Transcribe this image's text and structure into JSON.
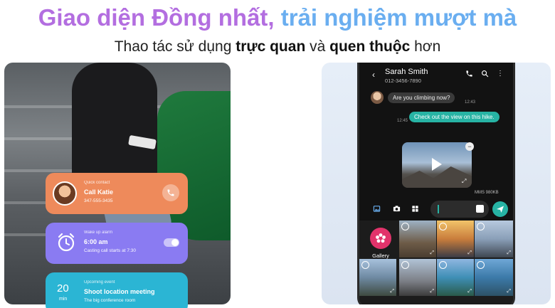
{
  "headline": {
    "part1": "Giao diện Đồng nhất,",
    "part2": "trải nghiệm mượt mà"
  },
  "subheadline": {
    "pre": "Thao tác sử dụng ",
    "bold1": "trực quan",
    "mid": " và ",
    "bold2": "quen thuộc",
    "post": " hơn"
  },
  "cards": {
    "call": {
      "category": "Quick contact",
      "title": "Call Katie",
      "detail": "347-555-3435",
      "icon": "phone-icon",
      "color": "#ee8a5b"
    },
    "alarm": {
      "category": "Wake up alarm",
      "title": "6:00 am",
      "detail": "Casting call starts at 7:30",
      "icon": "alarm-clock-icon",
      "toggle_on": true,
      "color": "#8a7bf2"
    },
    "event": {
      "category": "Upcoming event",
      "title": "Shoot location meeting",
      "detail": "The big conference room",
      "date_num": "20",
      "date_unit": "min",
      "color": "#2bb5d4"
    }
  },
  "messenger": {
    "contact_name": "Sarah Smith",
    "contact_number": "012-3456-7890",
    "messages": [
      {
        "direction": "in",
        "text": "Are you climbing now?",
        "time": "12:43"
      },
      {
        "direction": "out",
        "text": "Check out the view on this hike.",
        "time": "12:45"
      }
    ],
    "attachment": {
      "mms_label": "MMS",
      "size": "980KB"
    },
    "composer": {
      "accent": "#27b3a4"
    },
    "gallery_label": "Gallery",
    "thumbs": [
      {
        "selected": ""
      },
      {
        "selected": ""
      },
      {
        "selected": ""
      },
      {
        "selected": "1"
      },
      {
        "selected": ""
      },
      {
        "selected": ""
      },
      {
        "selected": ""
      },
      {
        "selected": ""
      }
    ]
  }
}
